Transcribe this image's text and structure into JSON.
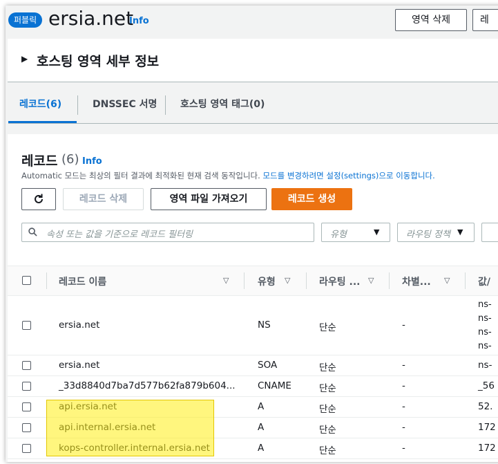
{
  "header": {
    "badge": "퍼블릭",
    "zone_name": "ersia.net",
    "info": "Info",
    "delete_zone": "영역 삭제",
    "edit_zone": "레"
  },
  "hosting_details": {
    "title": "호스팅 영역 세부 정보"
  },
  "tabs": [
    {
      "label": "레코드(6)",
      "active": true
    },
    {
      "label": "DNSSEC 서명",
      "active": false
    },
    {
      "label": "호스팅 영역 태그(0)",
      "active": false
    }
  ],
  "records": {
    "title": "레코드",
    "count": "(6)",
    "info": "Info",
    "desc_prefix": "Automatic 모드는 최상의 필터 결과에 최적화된 현재 검색 동작입니다.",
    "desc_link_a": "모드를 변경하려면 설정(settings)",
    "desc_suffix": "으로 이동합니다.",
    "btn_delete": "레코드 삭제",
    "btn_import": "영역 파일 가져오기",
    "btn_create": "레코드 생성",
    "search_placeholder": "속성 또는 값을 기준으로 레코드 필터링",
    "filter_type": "유형",
    "filter_routing": "라우팅 정책"
  },
  "table": {
    "columns": [
      "레코드 이름",
      "유형",
      "라우팅 ...",
      "차별...",
      "값/"
    ],
    "rows": [
      {
        "name": "ersia.net",
        "type": "NS",
        "routing": "단순",
        "diff": "-",
        "value": [
          "ns-",
          "ns-",
          "ns-",
          "ns-"
        ]
      },
      {
        "name": "ersia.net",
        "type": "SOA",
        "routing": "단순",
        "diff": "-",
        "value": [
          "ns-"
        ]
      },
      {
        "name": "_33d8840d7ba7d577b62fa879b604...",
        "type": "CNAME",
        "routing": "단순",
        "diff": "-",
        "value": [
          "_56"
        ]
      },
      {
        "name": "api.ersia.net",
        "type": "A",
        "routing": "단순",
        "diff": "-",
        "value": [
          "52."
        ]
      },
      {
        "name": "api.internal.ersia.net",
        "type": "A",
        "routing": "단순",
        "diff": "-",
        "value": [
          "172"
        ]
      },
      {
        "name": "kops-controller.internal.ersia.net",
        "type": "A",
        "routing": "단순",
        "diff": "-",
        "value": [
          "172"
        ]
      }
    ]
  },
  "colors": {
    "accent": "#0972d3",
    "primary_button": "#ec7211",
    "highlight": "#fff014"
  }
}
